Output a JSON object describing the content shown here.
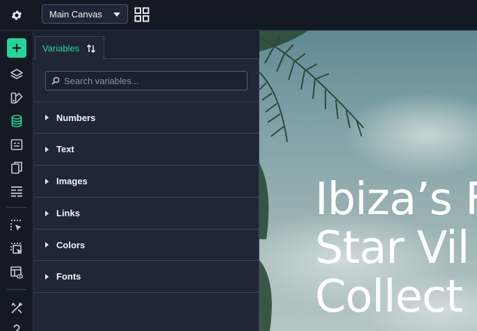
{
  "topbar": {
    "canvas_select": "Main Canvas"
  },
  "rail": {
    "icons": [
      "add-icon",
      "layers-icon",
      "assets-icon",
      "database-icon",
      "form-icon",
      "pages-icon",
      "components-icon",
      "select-element-icon",
      "select-multiple-icon",
      "preview-icon",
      "tools-icon",
      "help-icon"
    ]
  },
  "panel": {
    "tab_label": "Variables",
    "search_placeholder": "Search variables...",
    "sections": [
      "Numbers",
      "Text",
      "Images",
      "Links",
      "Colors",
      "Fonts"
    ]
  },
  "canvas": {
    "headline_lines": [
      "Ibiza’s F",
      "Star Vil",
      "Collect"
    ]
  },
  "colors": {
    "accent": "#2ad39b",
    "background": "#1f2736",
    "topbar": "#141a24"
  }
}
